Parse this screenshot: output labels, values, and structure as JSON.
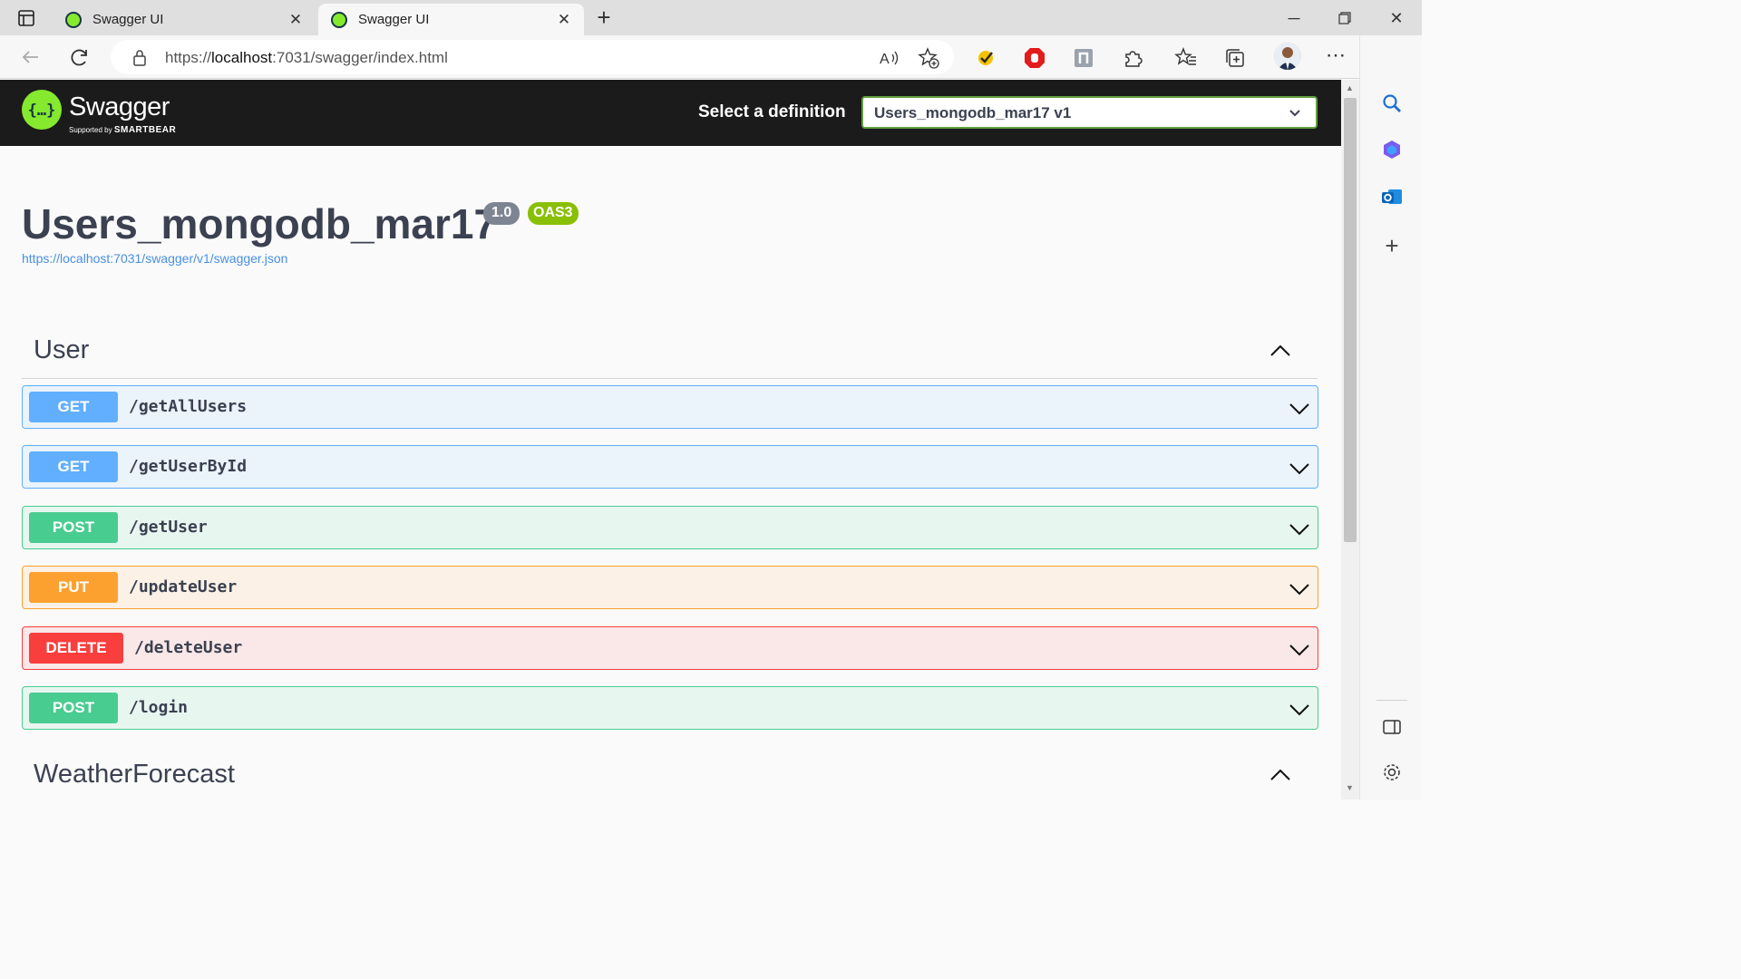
{
  "browser": {
    "tabs": [
      {
        "title": "Swagger UI",
        "active": false
      },
      {
        "title": "Swagger UI",
        "active": true
      }
    ],
    "url_prefix": "https://",
    "url_host": "localhost",
    "url_rest": ":7031/swagger/index.html"
  },
  "swagger": {
    "brand": "Swagger",
    "supported_by": "Supported by",
    "smartbear": "SMARTBEAR",
    "definition_label": "Select a definition",
    "definition_selected": "Users_mongodb_mar17 v1"
  },
  "info": {
    "title": "Users_mongodb_mar17",
    "version": "1.0",
    "oas": "OAS3",
    "spec_url": "https://localhost:7031/swagger/v1/swagger.json"
  },
  "sections": [
    {
      "name": "User",
      "operations": [
        {
          "method": "GET",
          "path": "/getAllUsers"
        },
        {
          "method": "GET",
          "path": "/getUserById"
        },
        {
          "method": "POST",
          "path": "/getUser"
        },
        {
          "method": "PUT",
          "path": "/updateUser"
        },
        {
          "method": "DELETE",
          "path": "/deleteUser"
        },
        {
          "method": "POST",
          "path": "/login"
        }
      ]
    },
    {
      "name": "WeatherForecast",
      "operations": []
    }
  ],
  "colors": {
    "get": "#61affe",
    "post": "#49cc90",
    "put": "#fca130",
    "delete": "#f93e3e",
    "swagger_green": "#85ea2d",
    "topbar": "#1b1b1b"
  }
}
